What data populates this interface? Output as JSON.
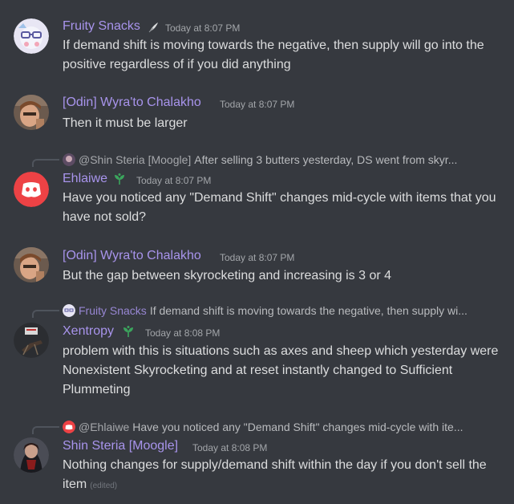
{
  "colors": {
    "background": "#36393f",
    "text": "#dcddde",
    "timestamp": "#a3a6aa",
    "name_purple": "#a894ec",
    "reply_text": "#b9bbbe",
    "discord_red": "#ed4245"
  },
  "messages": [
    {
      "author": "Fruity Snacks",
      "timestamp": "Today at 8:07 PM",
      "badge": "feather-icon",
      "text": "If demand shift is moving towards the negative, then supply will go into the positive regardless of if you did anything"
    },
    {
      "author": "[Odin] Wyra'to Chalakho",
      "timestamp": "Today at 8:07 PM",
      "text": "Then it must be larger"
    },
    {
      "reply": {
        "author": "@Shin Steria [Moogle]",
        "text": "After selling 3 butters yesterday, DS went from skyr..."
      },
      "author": "Ehlaiwe",
      "timestamp": "Today at 8:07 PM",
      "badge": "sprout-icon",
      "text": "Have you noticed any \"Demand Shift\" changes mid-cycle with items that you have not sold?"
    },
    {
      "author": "[Odin] Wyra'to Chalakho",
      "timestamp": "Today at 8:07 PM",
      "text": "But the gap between skyrocketing and increasing is 3 or 4"
    },
    {
      "reply": {
        "author": "Fruity Snacks",
        "text": "If demand shift is moving towards the negative, then supply wi..."
      },
      "author": "Xentropy",
      "timestamp": "Today at 8:08 PM",
      "badge": "sprout-icon",
      "text": "problem with this is situations such as axes and sheep which yesterday were Nonexistent Skyrocketing and at reset instantly changed to Sufficient Plummeting"
    },
    {
      "reply": {
        "author": "@Ehlaiwe",
        "text": "Have you noticed any \"Demand Shift\" changes mid-cycle with ite..."
      },
      "author": "Shin Steria [Moogle]",
      "timestamp": "Today at 8:08 PM",
      "text": "Nothing changes for supply/demand shift within the day if you don't sell the item",
      "edited": "(edited)"
    }
  ]
}
